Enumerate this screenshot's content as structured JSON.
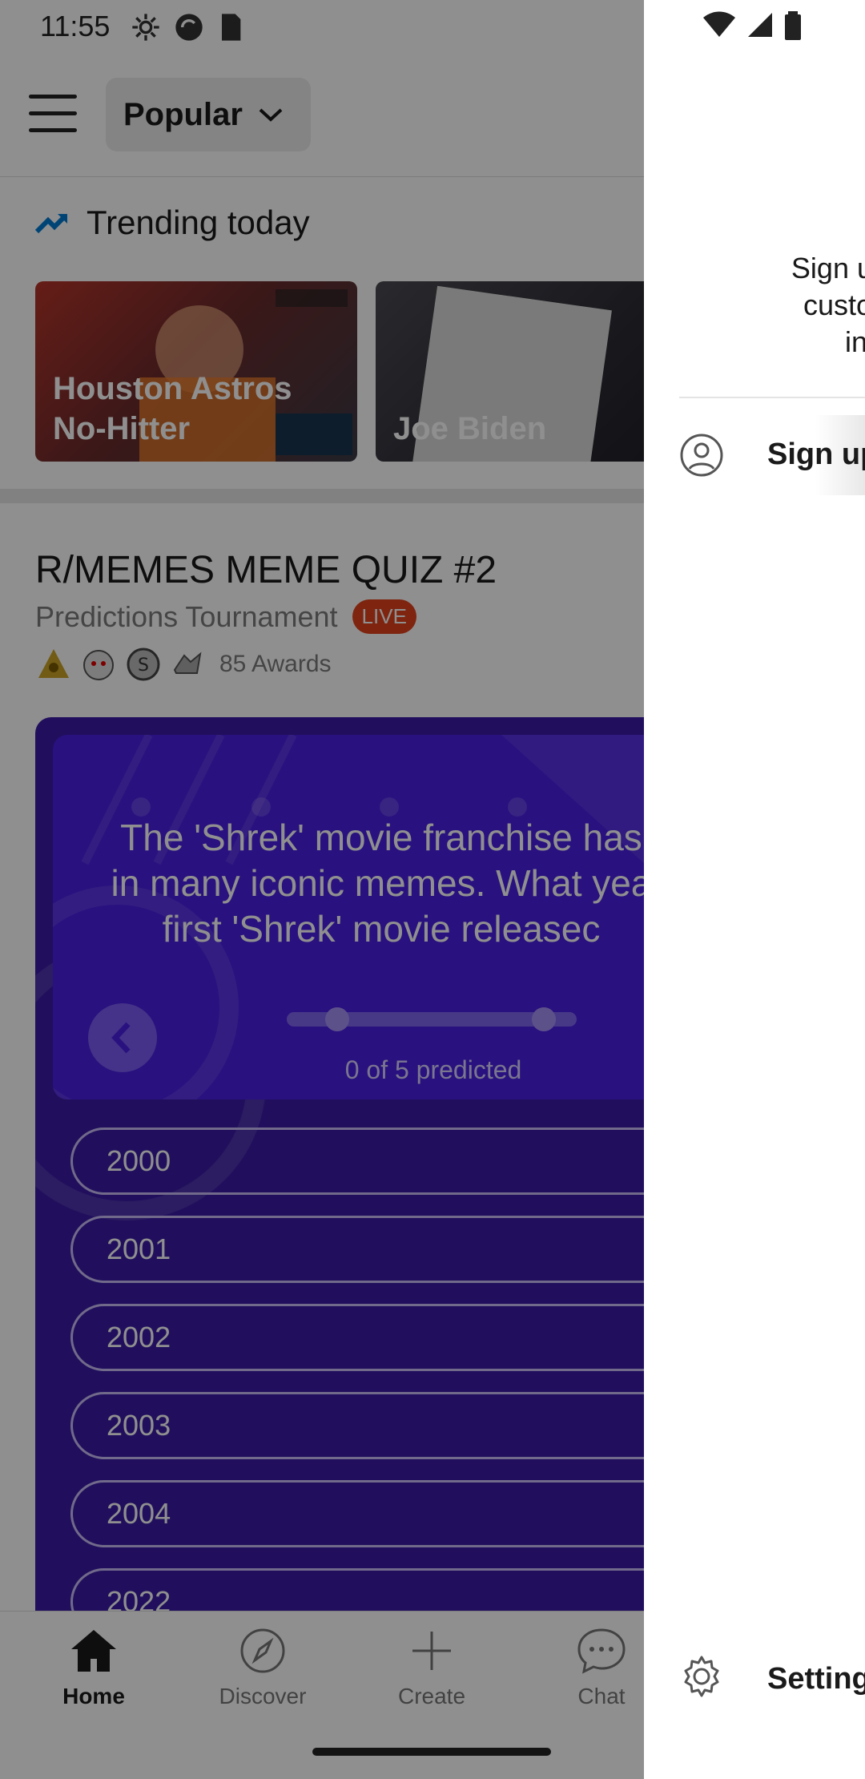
{
  "status_bar": {
    "time": "11:55"
  },
  "header": {
    "feed_label": "Popular"
  },
  "trending": {
    "title": "Trending today",
    "cards": [
      {
        "label_line1": "Houston Astros",
        "label_line2": "No-Hitter"
      },
      {
        "label_line1": "Joe Biden",
        "label_line2": ""
      }
    ]
  },
  "post": {
    "title": "R/MEMES MEME QUIZ #2",
    "subtitle": "Predictions Tournament",
    "badge": "LIVE",
    "awards": "85 Awards",
    "quiz": {
      "question_line1": "The 'Shrek' movie franchise has",
      "question_line2": "in many iconic memes. What yea",
      "question_line3": "first 'Shrek' movie releasec",
      "progress": "0 of 5 predicted",
      "options": [
        "2000",
        "2001",
        "2002",
        "2003",
        "2004",
        "2022"
      ]
    }
  },
  "bottom_nav": {
    "items": [
      {
        "label": "Home",
        "icon": "home-icon",
        "active": true
      },
      {
        "label": "Discover",
        "icon": "compass-icon"
      },
      {
        "label": "Create",
        "icon": "plus-icon"
      },
      {
        "label": "Chat",
        "icon": "chat-icon"
      }
    ]
  },
  "drawer": {
    "blurb_line1": "Sign up to u",
    "blurb_line2": "customize",
    "blurb_line3": "inte",
    "signup_label": "Sign up",
    "settings_label": "Settings"
  },
  "colors": {
    "quiz_bg": "#3b1ca6",
    "quiz_card": "#4a1fe2",
    "live_badge": "#e0401b",
    "trending_icon": "#0079d3"
  }
}
